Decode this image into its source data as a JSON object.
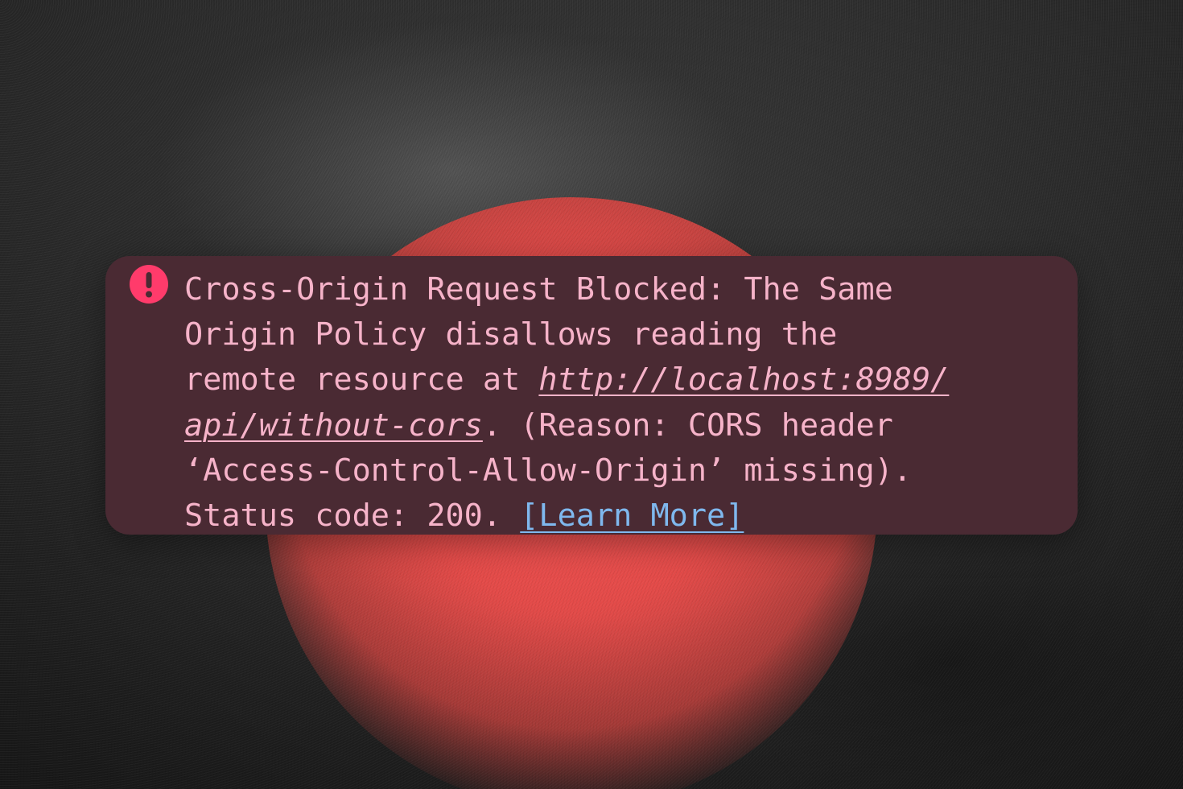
{
  "console_error": {
    "icon": "exclamation-circle-icon",
    "line1": "Cross-Origin Request Blocked: The Same",
    "line2": "Origin Policy disallows reading the",
    "line3_prefix": "remote resource at ",
    "url_part1": "http://localhost:8989/",
    "url_part2": "api/without-cors",
    "line4_suffix": ". (Reason: CORS header",
    "line5": "‘Access-Control-Allow-Origin’ missing).",
    "line6_prefix": "Status code: 200. ",
    "learn_more": "[Learn More]"
  },
  "colors": {
    "toast_background": "#4a2a33",
    "message_text": "#f6b3c9",
    "icon": "#ff3b6b",
    "link": "#7fb8ee",
    "backdrop_circle": "#e34a48"
  }
}
